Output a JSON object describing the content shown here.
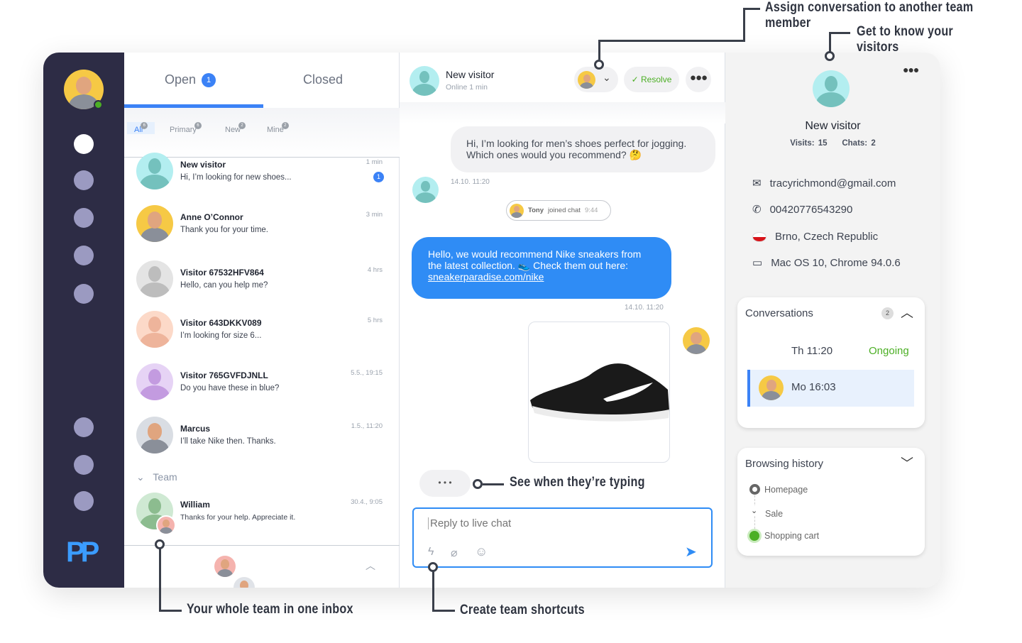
{
  "list": {
    "tabs": [
      {
        "label": "Open",
        "count": "1"
      },
      {
        "label": "Closed"
      }
    ],
    "filters": [
      {
        "label": "All",
        "count": "6"
      },
      {
        "label": "Primary",
        "count": "6"
      },
      {
        "label": "New",
        "count": "2"
      },
      {
        "label": "Mine",
        "count": "2"
      }
    ],
    "conversations": [
      {
        "name": "New visitor",
        "message": "Hi, I’m looking for new shoes...",
        "time": "1 min",
        "unread": "1"
      },
      {
        "name": "Anne O’Connor",
        "message": "Thank you for your time.",
        "time": "3 min"
      },
      {
        "name": "Visitor 67532HFV864",
        "message": "Hello, can you help me?",
        "time": "4 hrs"
      },
      {
        "name": "Visitor 643DKKV089",
        "message": "I’m looking for size 6...",
        "time": "5 hrs"
      },
      {
        "name": "Visitor 765GVFDJNLL",
        "message": "Do you have these in blue?",
        "time": "5.5., 19:15"
      },
      {
        "name": "Marcus",
        "message": "I’ll take Nike then. Thanks.",
        "time": "1.5., 11:20"
      }
    ],
    "team_label": "Team",
    "team_conversation": {
      "name": "William",
      "message": "Thanks for your help. Appreciate it.",
      "time": "30.4., 9:05"
    }
  },
  "chat": {
    "header": {
      "name": "New visitor",
      "status": "Online 1 min",
      "resolve_label": "Resolve"
    },
    "messages": [
      {
        "text": "Hi, I’m looking for men’s shoes perfect for jogging. Which ones would you recommend? 🤔",
        "time": "14.10. 11:20"
      },
      {
        "join_name": "Tony",
        "join_text": "joined chat",
        "join_time": "9:44"
      },
      {
        "text": "Hello, we would recommend Nike sneakers from the latest collection. 👟 Check them out here: ",
        "link": "sneakerparadise.com/nike",
        "time": "14.10. 11:20"
      }
    ],
    "typing": "• • •",
    "reply_placeholder": "Reply to live chat"
  },
  "visitor": {
    "name": "New visitor",
    "visits": "Visits: 15",
    "chats": "Chats: 2",
    "email": "tracyrichmond@gmail.com",
    "phone": "00420776543290",
    "location": "Brno, Czech Republic",
    "device": "Mac OS 10, Chrome 94.0.6",
    "conversations": {
      "title": "Conversations",
      "count": "2",
      "items": [
        {
          "time": "Th 11:20",
          "status": "Ongoing"
        },
        {
          "time": "Mo 16:03"
        }
      ]
    },
    "browsing": {
      "title": "Browsing history",
      "items": [
        "Homepage",
        "Sale",
        "Shopping cart"
      ]
    }
  },
  "annotations": {
    "assign": "Assign conversation to another team member",
    "know": "Get to know your visitors",
    "typing": "See when they’re typing",
    "team": "Your whole team in one inbox",
    "shortcuts": "Create team shortcuts"
  },
  "colors": {
    "accent": "#3b82f6",
    "sidebar": "#2d2c45",
    "success": "#4caf25"
  }
}
